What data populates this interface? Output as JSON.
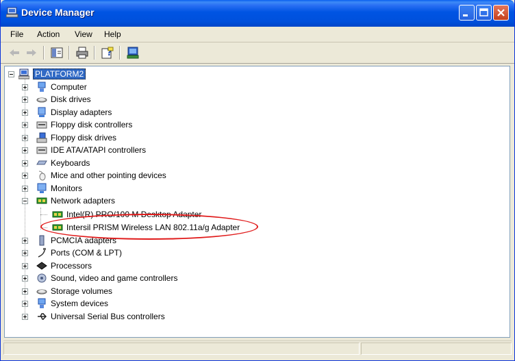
{
  "window": {
    "title": "Device Manager"
  },
  "menu": [
    "File",
    "Action",
    "View",
    "Help"
  ],
  "tree": {
    "root": "PLATFORM2",
    "categories": [
      {
        "label": "Computer",
        "icon": "computer-icon",
        "expanded": false
      },
      {
        "label": "Disk drives",
        "icon": "disk-drive-icon",
        "expanded": false
      },
      {
        "label": "Display adapters",
        "icon": "display-adapter-icon",
        "expanded": false
      },
      {
        "label": "Floppy disk controllers",
        "icon": "floppy-controller-icon",
        "expanded": false
      },
      {
        "label": "Floppy disk drives",
        "icon": "floppy-drive-icon",
        "expanded": false
      },
      {
        "label": "IDE ATA/ATAPI controllers",
        "icon": "ide-controller-icon",
        "expanded": false
      },
      {
        "label": "Keyboards",
        "icon": "keyboard-icon",
        "expanded": false
      },
      {
        "label": "Mice and other pointing devices",
        "icon": "mouse-icon",
        "expanded": false
      },
      {
        "label": "Monitors",
        "icon": "monitor-icon",
        "expanded": false
      },
      {
        "label": "Network adapters",
        "icon": "network-adapter-icon",
        "expanded": true,
        "children": [
          "Intel(R) PRO/100 M Desktop Adapter",
          "Intersil PRISM Wireless LAN 802.11a/g Adapter"
        ]
      },
      {
        "label": "PCMCIA adapters",
        "icon": "pcmcia-icon",
        "expanded": false
      },
      {
        "label": "Ports (COM & LPT)",
        "icon": "port-icon",
        "expanded": false
      },
      {
        "label": "Processors",
        "icon": "processor-icon",
        "expanded": false
      },
      {
        "label": "Sound, video and game controllers",
        "icon": "sound-icon",
        "expanded": false
      },
      {
        "label": "Storage volumes",
        "icon": "storage-icon",
        "expanded": false
      },
      {
        "label": "System devices",
        "icon": "system-devices-icon",
        "expanded": false
      },
      {
        "label": "Universal Serial Bus controllers",
        "icon": "usb-icon",
        "expanded": false
      }
    ]
  },
  "colors": {
    "titlebar": "#0054E3",
    "selection": "#316AC5",
    "highlight_ellipse": "#E01A1A"
  }
}
